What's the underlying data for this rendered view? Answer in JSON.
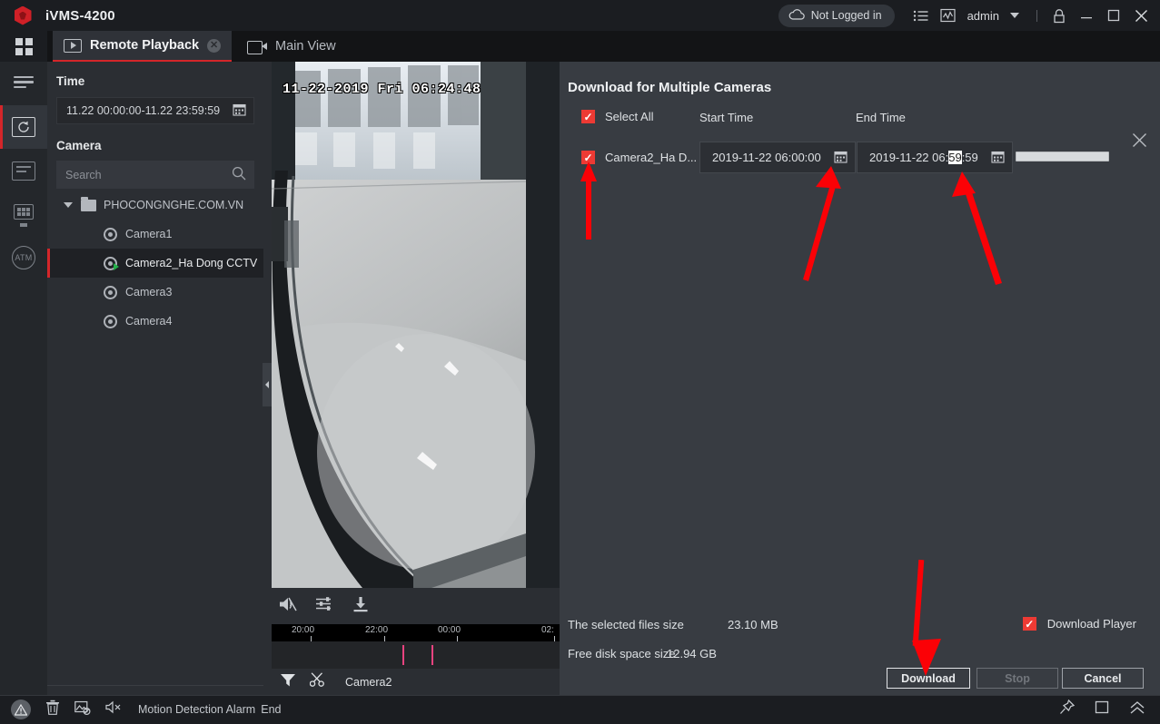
{
  "app": {
    "title": "iVMS-4200",
    "logo_icon": "hikvision-hex-logo",
    "accent_red": "#d4262a",
    "checkbox_red": "#ed3a34",
    "panel_bg": "#2b2e33",
    "dialog_bg": "#383c42"
  },
  "titlebar": {
    "login_status": "Not Logged in",
    "cloud_icon": "cloud-icon",
    "list_icon": "list-icon",
    "chart_icon": "chart-icon",
    "user": "admin",
    "caret_icon": "chevron-down-icon",
    "lock_icon": "lock-icon",
    "minimize_icon": "minimize-icon",
    "maximize_icon": "maximize-icon",
    "close_icon": "close-icon"
  },
  "tabs": {
    "grid_icon": "grid-apps-icon",
    "items": [
      {
        "label": "Remote Playback",
        "icon": "play-rect-icon",
        "active": true,
        "closable": true,
        "close_icon": "close-circle-icon"
      },
      {
        "label": "Main View",
        "icon": "video-camera-icon",
        "active": false,
        "closable": false
      }
    ]
  },
  "rail": {
    "items": [
      {
        "name": "menu",
        "icon": "hamburger-icon",
        "selected": false
      },
      {
        "name": "remote-playback",
        "icon": "playback-rewind-icon",
        "selected": true
      },
      {
        "name": "event-log",
        "icon": "document-lines-icon",
        "selected": false
      },
      {
        "name": "device-management",
        "icon": "device-panel-icon",
        "selected": false
      },
      {
        "name": "atm",
        "icon": "atm-circle-icon",
        "selected": false
      }
    ]
  },
  "leftpanel": {
    "time_label": "Time",
    "time_value": "11.22 00:00:00-11.22 23:59:59",
    "calendar_icon": "calendar-icon",
    "camera_label": "Camera",
    "search_placeholder": "Search",
    "search_icon": "search-icon",
    "tree": {
      "root": {
        "label": "PHOCONGNGHE.COM.VN",
        "icon": "folder-icon",
        "caret": "caret-down-icon",
        "expanded": true
      },
      "children": [
        {
          "label": "Camera1",
          "icon": "camera-dot-icon",
          "selected": false,
          "playing": false
        },
        {
          "label": "Camera2_Ha Dong CCTV",
          "icon": "camera-dot-icon",
          "selected": true,
          "playing": true
        },
        {
          "label": "Camera3",
          "icon": "camera-dot-icon",
          "selected": false,
          "playing": false
        },
        {
          "label": "Camera4",
          "icon": "camera-dot-icon",
          "selected": false,
          "playing": false
        }
      ]
    }
  },
  "video": {
    "overlay_timestamp": "11-22-2019 Fri 06:24:48",
    "collapse_handle_icon": "chevron-left-icon",
    "tools": [
      {
        "name": "audio-mute",
        "icon": "speaker-muted-icon"
      },
      {
        "name": "video-settings",
        "icon": "sliders-icon"
      },
      {
        "name": "download",
        "icon": "download-icon"
      }
    ],
    "timeline": {
      "ticks": [
        "20:00",
        "22:00",
        "00:00",
        "02:"
      ],
      "event_marker_color": "#e8437f",
      "filter_icon": "funnel-icon",
      "clip_icon": "scissors-icon",
      "camera_label": "Camera2"
    }
  },
  "dialog": {
    "title": "Download for Multiple Cameras",
    "close_icon": "close-icon",
    "columns": {
      "select_all": "Select All",
      "start_time": "Start Time",
      "end_time": "End Time"
    },
    "select_all_checked": true,
    "rows": [
      {
        "checked": true,
        "camera": "Camera2_Ha D...",
        "start_time": "2019-11-22 06:00:00",
        "end_time_prefix": "2019-11-22 06:",
        "end_time_selected": "59",
        "end_time_suffix": ":59",
        "end_time_full": "2019-11-22 06:59:59",
        "calendar_icon": "calendar-icon",
        "progress_percent": 100
      }
    ],
    "footer": {
      "selected_files_label": "The selected files size",
      "selected_files_value": "23.10 MB",
      "free_disk_label": "Free disk space size",
      "free_disk_value": "12.94 GB",
      "download_player_label": "Download Player",
      "download_player_checked": true
    },
    "buttons": {
      "download": "Download",
      "stop": "Stop",
      "cancel": "Cancel"
    }
  },
  "annotations": {
    "arrow_color": "#fb0106",
    "arrows": [
      {
        "name": "arrow-to-row-checkbox",
        "points_at": "row checkbox"
      },
      {
        "name": "arrow-to-start-time",
        "points_at": "start time field"
      },
      {
        "name": "arrow-to-end-time",
        "points_at": "end time field"
      },
      {
        "name": "arrow-to-download-button",
        "points_at": "Download button"
      }
    ]
  },
  "statusbar": {
    "alarm_icon": "alarm-triangle-icon",
    "trash_icon": "trash-icon",
    "image-alarm_icon": "image-off-icon",
    "sound_icon": "speaker-muted-icon",
    "message": "Motion Detection Alarm",
    "message_suffix": "End",
    "pin_icon": "pin-icon",
    "window_icon": "window-icon",
    "expand_icon": "chevrons-up-icon"
  }
}
